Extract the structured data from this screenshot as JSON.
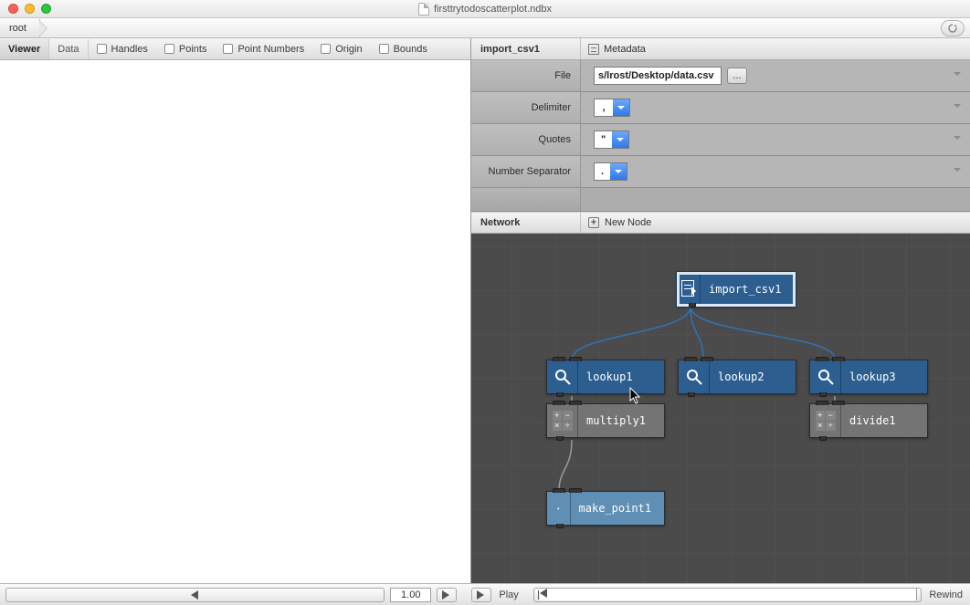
{
  "title": "firsttrytodoscatterplot.ndbx",
  "breadcrumb": "root",
  "left_tabs": {
    "viewer": "Viewer",
    "data": "Data"
  },
  "view_options": {
    "handles": "Handles",
    "points": "Points",
    "point_numbers": "Point Numbers",
    "origin": "Origin",
    "bounds": "Bounds"
  },
  "inspector": {
    "node_name": "import_csv1",
    "metadata_label": "Metadata",
    "rows": {
      "file": {
        "label": "File",
        "value": "s/lrost/Desktop/data.csv",
        "browse": "..."
      },
      "delimiter": {
        "label": "Delimiter",
        "value": ","
      },
      "quotes": {
        "label": "Quotes",
        "value": "\""
      },
      "numsep": {
        "label": "Number Separator",
        "value": "."
      }
    }
  },
  "network": {
    "label": "Network",
    "new_node": "New Node",
    "nodes": {
      "import": "import_csv1",
      "lookup1": "lookup1",
      "lookup2": "lookup2",
      "lookup3": "lookup3",
      "multiply1": "multiply1",
      "divide1": "divide1",
      "make_point1": "make_point1"
    }
  },
  "footer": {
    "frame": "1.00",
    "play": "Play",
    "rewind": "Rewind"
  }
}
